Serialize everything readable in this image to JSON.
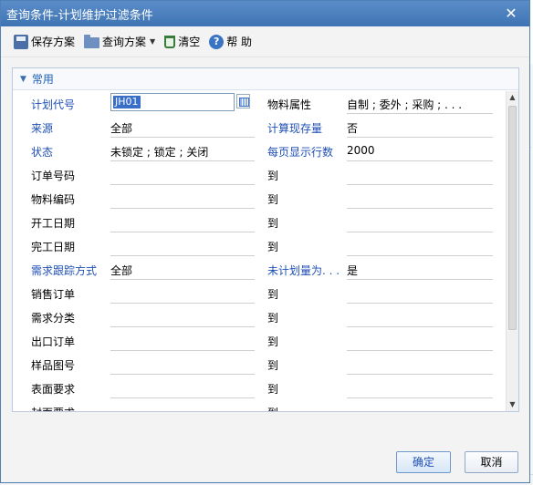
{
  "window": {
    "title": "查询条件-计划维护过滤条件"
  },
  "toolbar": {
    "save_scheme": "保存方案",
    "query_scheme": "查询方案",
    "clear": "清空",
    "help": "帮 助"
  },
  "panel": {
    "title": "常用"
  },
  "rows": [
    {
      "label": "计划代号",
      "label_blue": true,
      "value": "JH01",
      "right_label": "物料属性",
      "right_blue": false,
      "right_value": "自制 ; 委外 ; 采购 ; . . ."
    },
    {
      "label": "来源",
      "label_blue": true,
      "value": "全部",
      "right_label": "计算现存量",
      "right_blue": true,
      "right_value": "否"
    },
    {
      "label": "状态",
      "label_blue": true,
      "value": "未锁定 ; 锁定 ; 关闭",
      "right_label": "每页显示行数",
      "right_blue": true,
      "right_value": "2000"
    },
    {
      "label": "订单号码",
      "label_blue": false,
      "value": "",
      "right_label": "到",
      "right_blue": false,
      "right_value": ""
    },
    {
      "label": "物料编码",
      "label_blue": false,
      "value": "",
      "right_label": "到",
      "right_blue": false,
      "right_value": ""
    },
    {
      "label": "开工日期",
      "label_blue": false,
      "value": "",
      "right_label": "到",
      "right_blue": false,
      "right_value": ""
    },
    {
      "label": "完工日期",
      "label_blue": false,
      "value": "",
      "right_label": "到",
      "right_blue": false,
      "right_value": ""
    },
    {
      "label": "需求跟踪方式",
      "label_blue": true,
      "value": "全部",
      "right_label": "未计划量为. . .",
      "right_blue": true,
      "right_value": "是"
    },
    {
      "label": "销售订单",
      "label_blue": false,
      "value": "",
      "right_label": "到",
      "right_blue": false,
      "right_value": ""
    },
    {
      "label": "需求分类",
      "label_blue": false,
      "value": "",
      "right_label": "到",
      "right_blue": false,
      "right_value": ""
    },
    {
      "label": "出口订单",
      "label_blue": false,
      "value": "",
      "right_label": "到",
      "right_blue": false,
      "right_value": ""
    },
    {
      "label": "样品图号",
      "label_blue": false,
      "value": "",
      "right_label": "到",
      "right_blue": false,
      "right_value": ""
    },
    {
      "label": "表面要求",
      "label_blue": false,
      "value": "",
      "right_label": "到",
      "right_blue": false,
      "right_value": ""
    },
    {
      "label": "封面要求",
      "label_blue": false,
      "value": "",
      "right_label": "到",
      "right_blue": false,
      "right_value": ""
    }
  ],
  "buttons": {
    "ok": "确定",
    "cancel": "取消"
  },
  "background": {
    "tick": "号"
  }
}
